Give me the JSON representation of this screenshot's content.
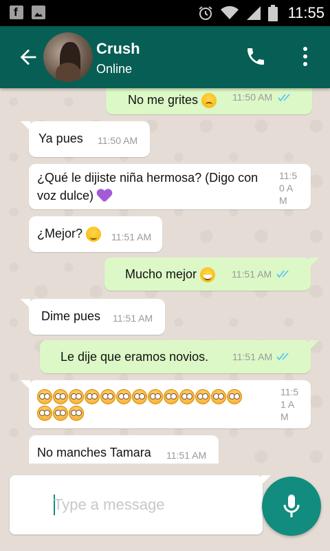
{
  "status_bar": {
    "time": "11:55"
  },
  "header": {
    "name": "Crush",
    "status": "Online"
  },
  "messages": [
    {
      "dir": "out",
      "text": "No me grites",
      "time": "11:50 AM"
    },
    {
      "dir": "in",
      "text": "Ya pues",
      "time": "11:50 AM"
    },
    {
      "dir": "in",
      "text_line1": "¿Qué le dijiste niña hermosa? (Digo con",
      "text_line2": "voz dulce)",
      "time": "11:50 AM"
    },
    {
      "dir": "in",
      "text": "¿Mejor?",
      "time": "11:51 AM"
    },
    {
      "dir": "out",
      "text": "Mucho mejor",
      "time": "11:51 AM"
    },
    {
      "dir": "in",
      "text": "Dime pues",
      "time": "11:51 AM"
    },
    {
      "dir": "out",
      "text": "Le dije que eramos novios.",
      "time": "11:51 AM"
    },
    {
      "dir": "in",
      "emoji_count": 16,
      "time": "11:51 AM"
    },
    {
      "dir": "in",
      "text": "No manches Tamara",
      "time": "11:51 AM"
    }
  ],
  "input": {
    "placeholder": "Type a message"
  },
  "colors": {
    "header": "#075e54",
    "accent": "#128c7e",
    "outgoing": "#dcf8c6",
    "incoming": "#ffffff",
    "tick": "#4fc3f7"
  },
  "icons": [
    "facebook-icon",
    "gallery-icon",
    "alarm-icon",
    "wifi-icon",
    "signal-icon",
    "battery-icon",
    "back-arrow-icon",
    "phone-icon",
    "more-vert-icon",
    "mic-icon",
    "double-check-icon"
  ]
}
